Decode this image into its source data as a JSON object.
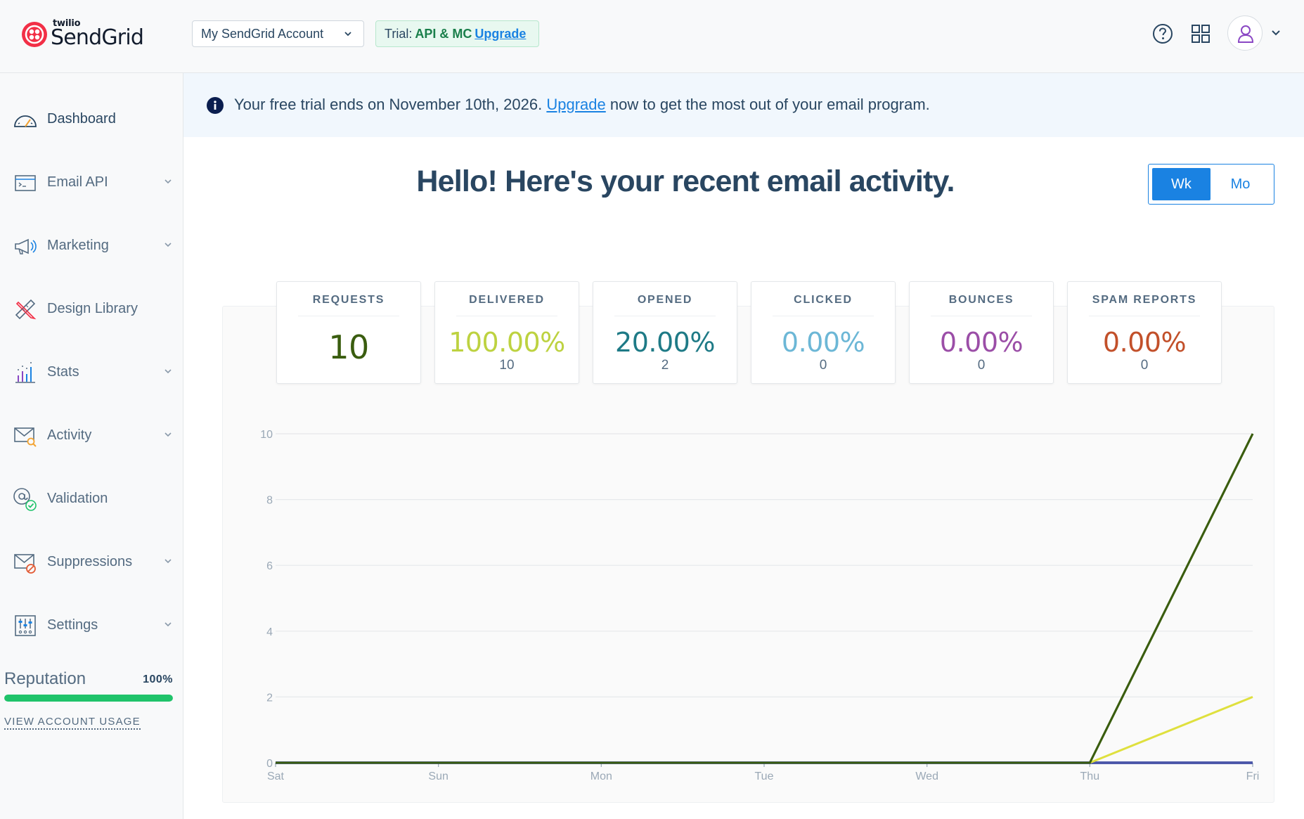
{
  "header": {
    "logo_small": "twilio",
    "logo_brand": "SendGrid",
    "account_name": "My SendGrid Account",
    "trial_label": "Trial:",
    "trial_plan": "API & MC",
    "trial_upgrade": "Upgrade",
    "icons": [
      "help-circle-icon",
      "apps-grid-icon",
      "user-icon",
      "chevron-down-icon"
    ]
  },
  "sidebar": {
    "items": [
      {
        "label": "Dashboard",
        "icon": "speedometer-icon",
        "expandable": false,
        "active": true
      },
      {
        "label": "Email API",
        "icon": "code-window-icon",
        "expandable": true
      },
      {
        "label": "Marketing",
        "icon": "megaphone-icon",
        "expandable": true
      },
      {
        "label": "Design Library",
        "icon": "ruler-pencil-icon",
        "expandable": false
      },
      {
        "label": "Stats",
        "icon": "bar-chart-icon",
        "expandable": true
      },
      {
        "label": "Activity",
        "icon": "envelope-search-icon",
        "expandable": true
      },
      {
        "label": "Validation",
        "icon": "at-check-icon",
        "expandable": false
      },
      {
        "label": "Suppressions",
        "icon": "envelope-block-icon",
        "expandable": true
      },
      {
        "label": "Settings",
        "icon": "sliders-icon",
        "expandable": true
      }
    ],
    "reputation": {
      "label": "Reputation",
      "percent_text": "100%",
      "value": 100,
      "bar_color": "#1fc36a"
    },
    "usage_link": "VIEW ACCOUNT USAGE"
  },
  "banner": {
    "icon": "info-icon",
    "text_before": "Your free trial ends on November 10th, 2026.",
    "link": "Upgrade",
    "text_after": "now to get the most out of your email program."
  },
  "main": {
    "title": "Hello! Here's your recent email activity.",
    "period_toggle": [
      {
        "label": "Wk",
        "selected": true
      },
      {
        "label": "Mo",
        "selected": false
      }
    ],
    "stats": [
      {
        "title": "REQUESTS",
        "value": "10",
        "count": "",
        "color": "#3a5d0f"
      },
      {
        "title": "DELIVERED",
        "value": "100.00%",
        "count": "10",
        "color": "#bdd240"
      },
      {
        "title": "OPENED",
        "value": "20.00%",
        "count": "2",
        "color": "#1e7a86"
      },
      {
        "title": "CLICKED",
        "value": "0.00%",
        "count": "0",
        "color": "#6cb7d6"
      },
      {
        "title": "BOUNCES",
        "value": "0.00%",
        "count": "0",
        "color": "#9b4ea7"
      },
      {
        "title": "SPAM REPORTS",
        "value": "0.00%",
        "count": "0",
        "color": "#c2502a"
      }
    ]
  },
  "chart_data": {
    "type": "line",
    "categories": [
      "Sat",
      "Sun",
      "Mon",
      "Tue",
      "Wed",
      "Thu",
      "Fri"
    ],
    "ylim": [
      0,
      10
    ],
    "yticks": [
      0,
      2,
      4,
      6,
      8,
      10
    ],
    "grid": true,
    "series": [
      {
        "values": [
          0,
          0,
          0,
          0,
          0,
          0,
          10
        ],
        "color": "#3a5d0f"
      },
      {
        "values": [
          0,
          0,
          0,
          0,
          0,
          0,
          10
        ],
        "color": "#3a5d0f"
      },
      {
        "values": [
          0,
          0,
          0,
          0,
          0,
          0,
          2
        ],
        "color": "#dfe03e"
      },
      {
        "values": [
          0,
          0,
          0,
          0,
          0,
          0,
          0
        ],
        "color": "#4a56a8"
      },
      {
        "values": [
          0,
          0,
          0,
          0,
          0,
          0,
          0
        ],
        "color": "#4a56a8"
      },
      {
        "values": [
          0,
          0,
          0,
          0,
          0,
          0,
          0
        ],
        "color": "#4a56a8"
      }
    ]
  }
}
